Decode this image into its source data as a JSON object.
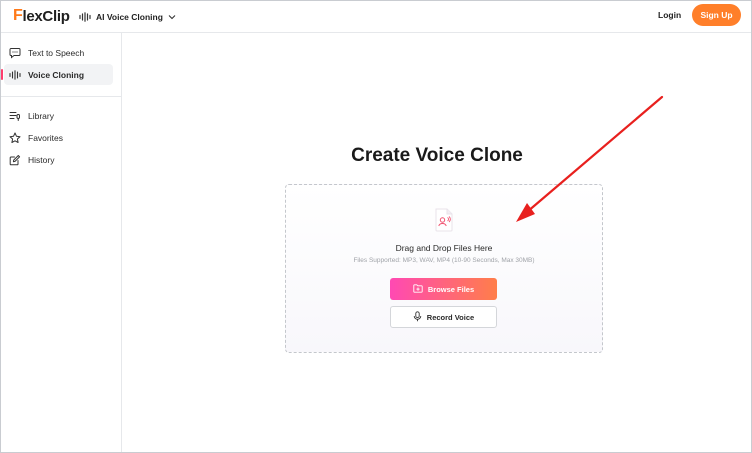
{
  "header": {
    "logo": {
      "first": "F",
      "rest": "lexClip"
    },
    "tool_switch": {
      "label": "AI Voice Cloning",
      "icon": "waveform-icon"
    },
    "login_label": "Login",
    "signup_label": "Sign Up"
  },
  "sidebar": {
    "items": [
      {
        "label": "Text to Speech",
        "icon": "chat-bubble-icon",
        "active": false
      },
      {
        "label": "Voice Cloning",
        "icon": "waveform-icon",
        "active": true
      },
      {
        "label": "Library",
        "icon": "library-icon",
        "active": false
      },
      {
        "label": "Favorites",
        "icon": "star-icon",
        "active": false
      },
      {
        "label": "History",
        "icon": "edit-icon",
        "active": false
      }
    ]
  },
  "main": {
    "title": "Create Voice Clone",
    "dropzone": {
      "title": "Drag and Drop Files Here",
      "subtitle": "Files Supported: MP3, WAV, MP4 (10-90 Seconds, Max 30MB)",
      "browse_label": "Browse Files",
      "record_label": "Record Voice"
    }
  },
  "colors": {
    "accent": "#ff7f2a",
    "gradient_start": "#ff49b3",
    "gradient_end": "#ff7e4a",
    "annotation_arrow": "#e8201e",
    "active_indicator": "#ff3d6e"
  }
}
